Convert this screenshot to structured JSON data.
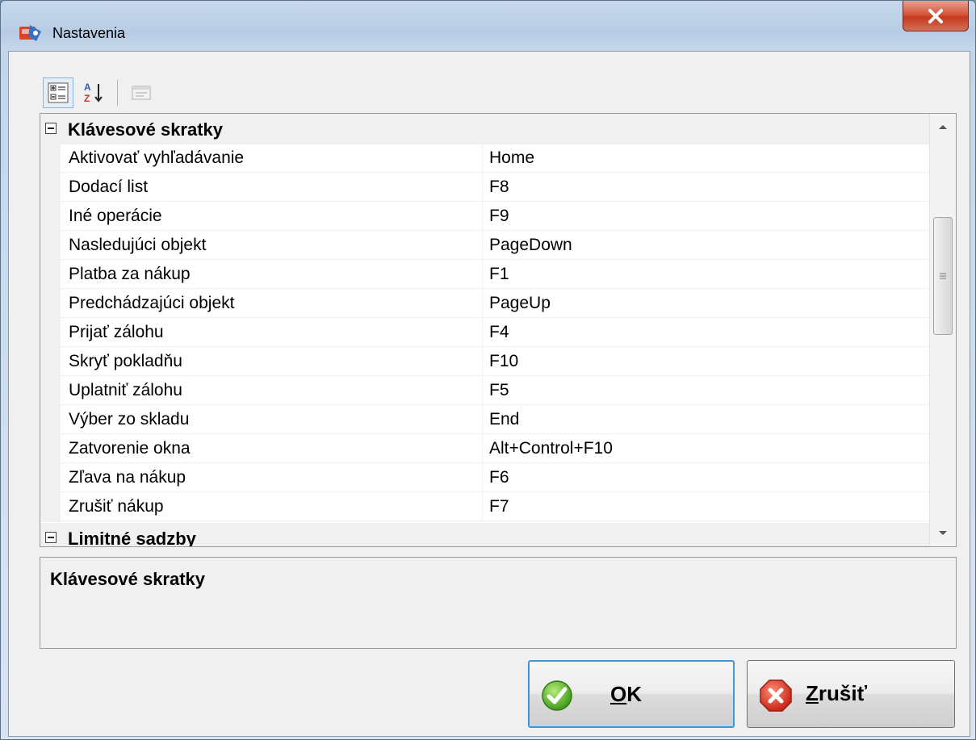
{
  "window": {
    "title": "Nastavenia"
  },
  "toolbar": {
    "buttons": [
      {
        "name": "categorized-view",
        "icon": "categorized-icon",
        "active": true
      },
      {
        "name": "alphabetical-sort",
        "icon": "sort-az-icon",
        "active": false
      },
      {
        "name": "property-pages",
        "icon": "property-pages-icon",
        "active": false,
        "disabled": true
      }
    ]
  },
  "grid": {
    "categories": [
      {
        "label": "Klávesové skratky",
        "expanded": true,
        "properties": [
          {
            "name": "Aktivovať vyhľadávanie",
            "value": "Home"
          },
          {
            "name": "Dodací list",
            "value": "F8"
          },
          {
            "name": "Iné operácie",
            "value": "F9"
          },
          {
            "name": "Nasledujúci objekt",
            "value": "PageDown"
          },
          {
            "name": "Platba za nákup",
            "value": "F1"
          },
          {
            "name": "Predchádzajúci objekt",
            "value": "PageUp"
          },
          {
            "name": "Prijať zálohu",
            "value": "F4"
          },
          {
            "name": "Skryť pokladňu",
            "value": "F10"
          },
          {
            "name": "Uplatniť zálohu",
            "value": "F5"
          },
          {
            "name": "Výber zo skladu",
            "value": "End"
          },
          {
            "name": "Zatvorenie okna",
            "value": "Alt+Control+F10"
          },
          {
            "name": "Zľava na nákup",
            "value": "F6"
          },
          {
            "name": "Zrušiť nákup",
            "value": "F7"
          }
        ]
      },
      {
        "label": "Limitné sadzby",
        "expanded": true,
        "properties": []
      }
    ]
  },
  "help": {
    "title": "Klávesové skratky"
  },
  "buttons": {
    "ok": {
      "mnemonic": "O",
      "rest": "K",
      "icon": "check-icon"
    },
    "cancel": {
      "mnemonic": "Z",
      "rest": "rušiť",
      "icon": "cancel-x-icon"
    }
  },
  "colors": {
    "ok_icon": "#5cb82a",
    "cancel_icon": "#e0412f",
    "focus_border": "#3c98d8"
  }
}
